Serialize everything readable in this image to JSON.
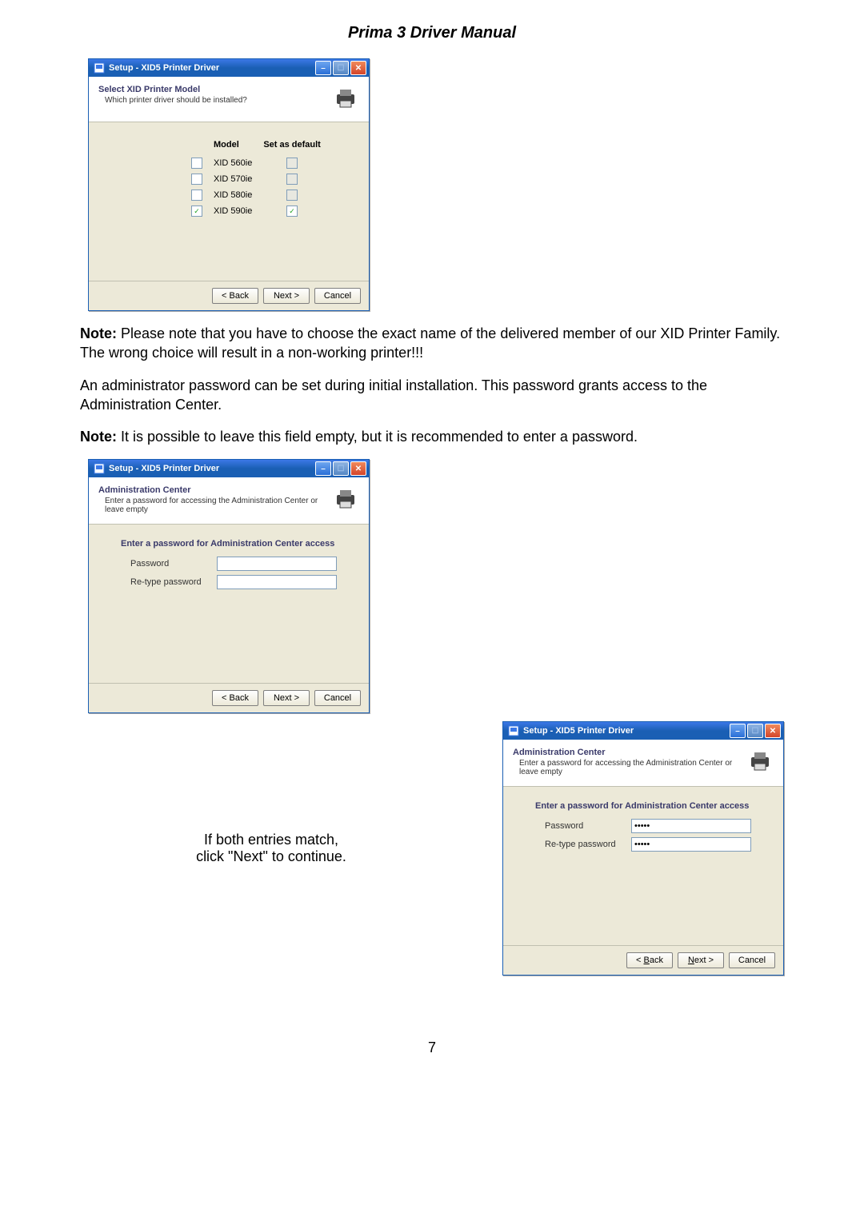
{
  "doc_title": "Prima 3 Driver Manual",
  "page_number": "7",
  "win_common": {
    "title": "Setup - XID5 Printer Driver",
    "min_label": "–",
    "max_label": "☐",
    "close_label": "✕",
    "back": "< Back",
    "next": "Next >",
    "cancel": "Cancel",
    "back_u": "< Back",
    "next_u": "Next >"
  },
  "dialog1": {
    "hdr_title": "Select XID Printer Model",
    "hdr_sub": "Which printer driver should be installed?",
    "col_model": "Model",
    "col_default": "Set as default",
    "rows": [
      {
        "label": "XID 560ie",
        "checked": false,
        "def_disabled": true
      },
      {
        "label": "XID 570ie",
        "checked": false,
        "def_disabled": true
      },
      {
        "label": "XID 580ie",
        "checked": false,
        "def_disabled": true
      },
      {
        "label": "XID 590ie",
        "checked": true,
        "def_disabled": false,
        "def_checked": true
      }
    ]
  },
  "para1a": "Note:",
  "para1b": " Please note that you have to choose the exact name of the delivered member of our XID Printer Family. The wrong choice will result in a non-working printer!!!",
  "para2": "An administrator password can be set during initial installation. This password grants access to the Administration Center.",
  "para3a": "Note:",
  "para3b": " It is possible to leave this field empty, but it is recommended to enter a password.",
  "dialog2": {
    "hdr_title": "Administration Center",
    "hdr_sub": "Enter a password for accessing the Administration Center or leave empty",
    "form_title": "Enter a password for Administration Center access",
    "pw_label": "Password",
    "pw2_label": "Re-type password",
    "pw_value": "",
    "pw2_value": ""
  },
  "caption_line1": "If both entries match,",
  "caption_line2_a": "click \"",
  "caption_line2_b": "Next",
  "caption_line2_c": "\" to continue.",
  "dialog3": {
    "hdr_title": "Administration Center",
    "hdr_sub": "Enter a password for accessing the Administration Center or leave empty",
    "form_title": "Enter a password for Administration Center access",
    "pw_label": "Password",
    "pw2_label": "Re-type password",
    "pw_value": "•••••",
    "pw2_value": "•••••"
  }
}
